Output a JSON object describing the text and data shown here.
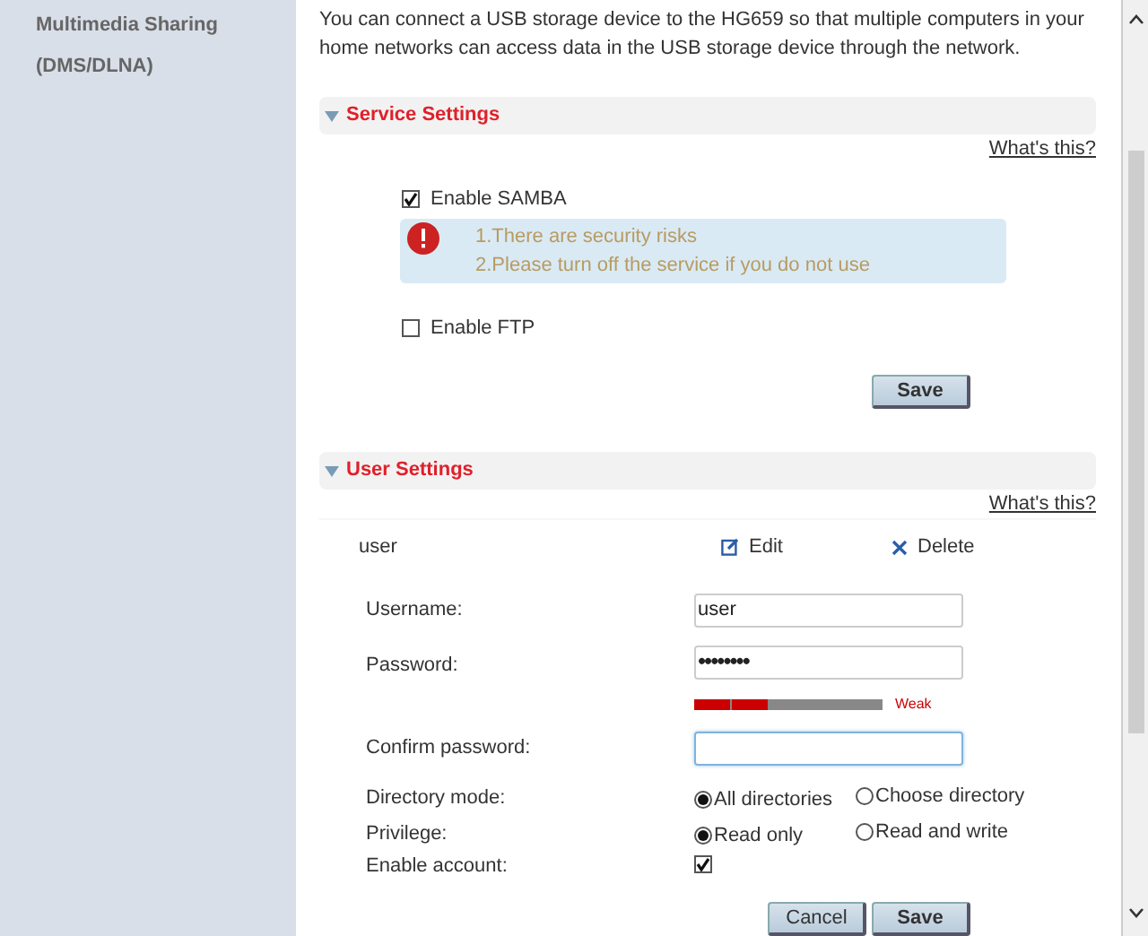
{
  "sidebar": {
    "items": [
      {
        "label": "Multimedia Sharing",
        "selected": false
      },
      {
        "label": "(DMS/DLNA)",
        "selected": false
      }
    ]
  },
  "description": "You can connect a USB storage device to the HG659 so that multiple computers in your home networks can access data in the USB storage device through the network.",
  "service_settings": {
    "title": "Service Settings",
    "expanded": true,
    "help_link": "What's this?",
    "options": [
      {
        "label": "Enable SAMBA",
        "checked": true,
        "warnings": [
          "1.There are security risks",
          "2.Please turn off the service if you do not use"
        ]
      },
      {
        "label": "Enable FTP",
        "checked": false
      }
    ],
    "save_button": "Save"
  },
  "user_settings": {
    "title": "User Settings",
    "expanded": true,
    "help_link": "What's this?",
    "user": {
      "name": "user",
      "edit": "Edit",
      "delete": "Delete"
    },
    "fields": [
      {
        "kind": "text",
        "label": "Username:",
        "value": "user"
      },
      {
        "kind": "password",
        "label": "Password:",
        "value": "••••••••",
        "strength": {
          "level": 0.4,
          "label": "Weak"
        }
      },
      {
        "kind": "password",
        "label": "Confirm password:",
        "focused": true
      },
      {
        "kind": "radio",
        "label": "Directory mode:",
        "options": [
          {
            "label": "All directories",
            "selected": true
          },
          {
            "label": "Choose directory",
            "selected": false
          }
        ]
      },
      {
        "kind": "radio",
        "label": "Privilege:",
        "options": [
          {
            "label": "Read only",
            "selected": true
          },
          {
            "label": "Read and write",
            "selected": false
          }
        ]
      },
      {
        "kind": "checkbox",
        "label": "Enable account:",
        "checked": true
      }
    ],
    "buttons": [
      "Cancel",
      "Save"
    ]
  }
}
